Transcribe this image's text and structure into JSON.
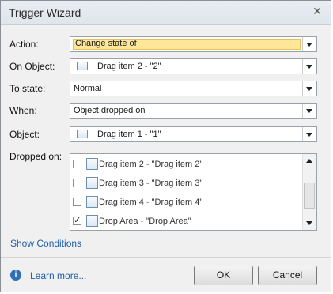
{
  "window": {
    "title": "Trigger Wizard",
    "close_glyph": "✕"
  },
  "form": {
    "action": {
      "label": "Action:",
      "value": "Change state of"
    },
    "on_object": {
      "label": "On Object:",
      "value": "Drag item 2 - \"2\"",
      "icon": "object-icon"
    },
    "to_state": {
      "label": "To state:",
      "value": "Normal"
    },
    "when": {
      "label": "When:",
      "value": "Object dropped on"
    },
    "object": {
      "label": "Object:",
      "value": "Drag item 1 - \"1\"",
      "icon": "object-icon"
    },
    "dropped_on": {
      "label": "Dropped on:",
      "items": [
        {
          "label": "Drag item 2 - \"Drag item 2\"",
          "checked": false
        },
        {
          "label": "Drag item 3 - \"Drag item 3\"",
          "checked": false
        },
        {
          "label": "Drag item 4 - \"Drag item 4\"",
          "checked": false
        },
        {
          "label": "Drop Area - \"Drop Area\"",
          "checked": true
        }
      ]
    }
  },
  "links": {
    "show_conditions": "Show Conditions",
    "learn_more": "Learn more..."
  },
  "buttons": {
    "ok": "OK",
    "cancel": "Cancel"
  },
  "colors": {
    "highlight": "#ffe79a",
    "link": "#1f5fae",
    "info": "#2f6fb8"
  }
}
